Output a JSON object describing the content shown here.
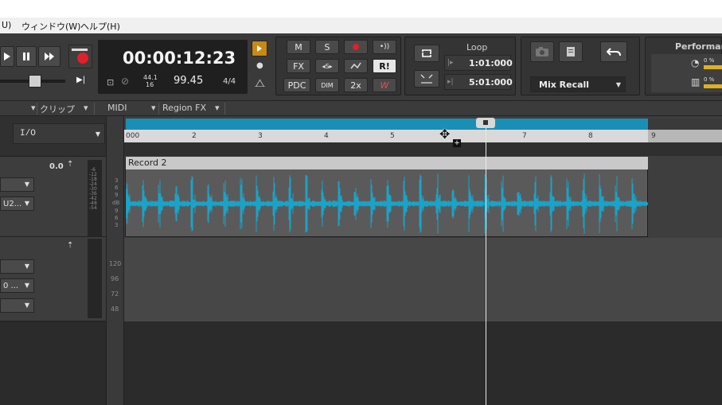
{
  "menu": {
    "items": [
      "U)",
      "ウィンドウ(W)",
      "ヘルプ(H)"
    ]
  },
  "transport": {
    "time": "00:00:12:23",
    "sample_rate_top": "44.1",
    "sample_rate_bottom": "16",
    "tempo": "99.45",
    "meter": "4/4"
  },
  "mix": {
    "m": "M",
    "s": "S",
    "fx": "FX",
    "r": "R!",
    "pdc": "PDC",
    "dim": "DIM",
    "twox": "2x",
    "w": "W"
  },
  "loop": {
    "title": "Loop",
    "start": "1:01:000",
    "end": "5:01:000"
  },
  "recall": {
    "label": "Mix Recall"
  },
  "performance": {
    "title": "Performance",
    "pct1": "0 %",
    "pct2": "0 %"
  },
  "toolbar": {
    "clip": "クリップ",
    "midi": "MIDI",
    "regionfx": "Region FX"
  },
  "track": {
    "io": "I/O",
    "volume": "0.0",
    "input": "U2...",
    "input2": "0 ..."
  },
  "meter_scale": [
    "-6",
    "-12",
    "-18",
    "-24",
    "-30",
    "-36",
    "-42",
    "-48",
    "-54"
  ],
  "vscale": [
    "3",
    "6",
    "9",
    "dB",
    "9",
    "6",
    "3"
  ],
  "vscale2": [
    "120",
    "96",
    "72",
    "48"
  ],
  "ruler": [
    "000",
    "2",
    "3",
    "4",
    "5",
    "7",
    "8",
    "9"
  ],
  "clip": {
    "title": "Record 2"
  },
  "colors": {
    "accent": "#1a8fb5",
    "record": "#e0202a",
    "waveform": "#1aa3c8"
  }
}
